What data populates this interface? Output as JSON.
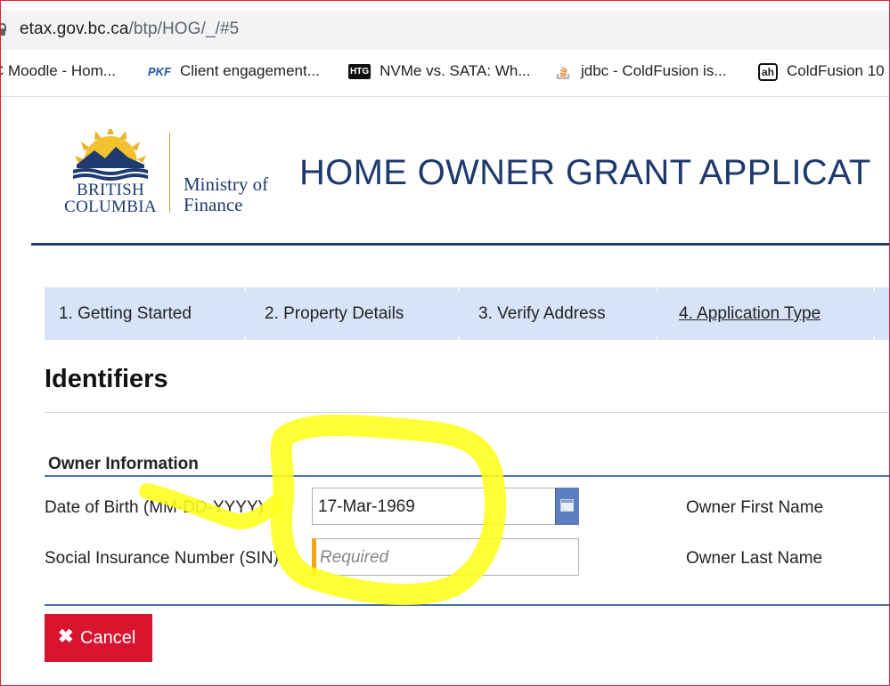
{
  "browser": {
    "url_host": "etax.gov.bc.ca",
    "url_path": "/btp/HOG/_/#5",
    "bookmarks": [
      {
        "label": "C Moodle - Hom...",
        "icon": "moodle-icon"
      },
      {
        "label": "Client engagement...",
        "icon": "pkf-icon",
        "icon_text": "PKF"
      },
      {
        "label": "NVMe vs. SATA: Wh...",
        "icon": "htg-icon",
        "icon_text": "HTG"
      },
      {
        "label": "jdbc - ColdFusion is...",
        "icon": "stackoverflow-icon"
      },
      {
        "label": "ColdFusion 10",
        "icon": "ah-icon",
        "icon_text": "ah"
      }
    ]
  },
  "header": {
    "logo_line1": "BRITISH",
    "logo_line2": "COLUMBIA",
    "ministry_line1": "Ministry of",
    "ministry_line2": "Finance",
    "title": "HOME OWNER GRANT APPLICAT"
  },
  "steps": [
    {
      "label": "1. Getting Started",
      "active": false
    },
    {
      "label": "2. Property Details",
      "active": false
    },
    {
      "label": "3. Verify Address",
      "active": false
    },
    {
      "label": "4. Application Type",
      "active": true
    }
  ],
  "section": {
    "title": "Identifiers",
    "subheading": "Owner Information"
  },
  "form": {
    "dob_label": "Date of Birth (MM-DD-YYYY)",
    "dob_value": "17-Mar-1969",
    "sin_label": "Social Insurance Number (SIN)",
    "sin_placeholder": "Required",
    "first_name_label": "Owner First Name",
    "last_name_label": "Owner Last Name"
  },
  "actions": {
    "cancel_icon": "✖",
    "cancel_label": "Cancel"
  },
  "colors": {
    "brand_navy": "#1e3a6e",
    "step_bg": "#d7e4f8",
    "cancel_red": "#d8142e",
    "highlight_yellow": "#ffff1a"
  }
}
